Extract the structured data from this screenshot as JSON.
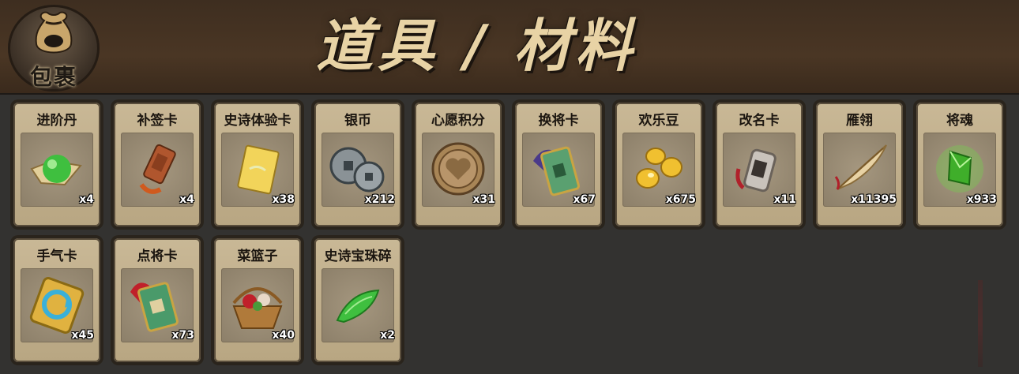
{
  "header": {
    "bag_label": "包裹",
    "title": "道具 / 材料"
  },
  "items": [
    {
      "name": "进阶丹",
      "count": "x4",
      "icon": "green-orb-icon"
    },
    {
      "name": "补签卡",
      "count": "x4",
      "icon": "bronze-tag-icon"
    },
    {
      "name": "史诗体验卡",
      "count": "x38",
      "icon": "gold-card-icon"
    },
    {
      "name": "银币",
      "count": "x212",
      "icon": "silver-coins-icon"
    },
    {
      "name": "心愿积分",
      "count": "x31",
      "icon": "heart-coin-icon"
    },
    {
      "name": "换将卡",
      "count": "x67",
      "icon": "jade-tablet-icon"
    },
    {
      "name": "欢乐豆",
      "count": "x675",
      "icon": "gold-beans-icon"
    },
    {
      "name": "改名卡",
      "count": "x11",
      "icon": "name-tag-icon"
    },
    {
      "name": "雁翎",
      "count": "x11395",
      "icon": "feather-icon"
    },
    {
      "name": "将魂",
      "count": "x933",
      "icon": "green-crystal-icon"
    },
    {
      "name": "手气卡",
      "count": "x45",
      "icon": "luck-card-icon"
    },
    {
      "name": "点将卡",
      "count": "x73",
      "icon": "general-tablet-icon"
    },
    {
      "name": "菜篮子",
      "count": "x40",
      "icon": "basket-icon"
    },
    {
      "name": "史诗宝珠碎",
      "count": "x2",
      "icon": "jade-shard-icon"
    }
  ]
}
